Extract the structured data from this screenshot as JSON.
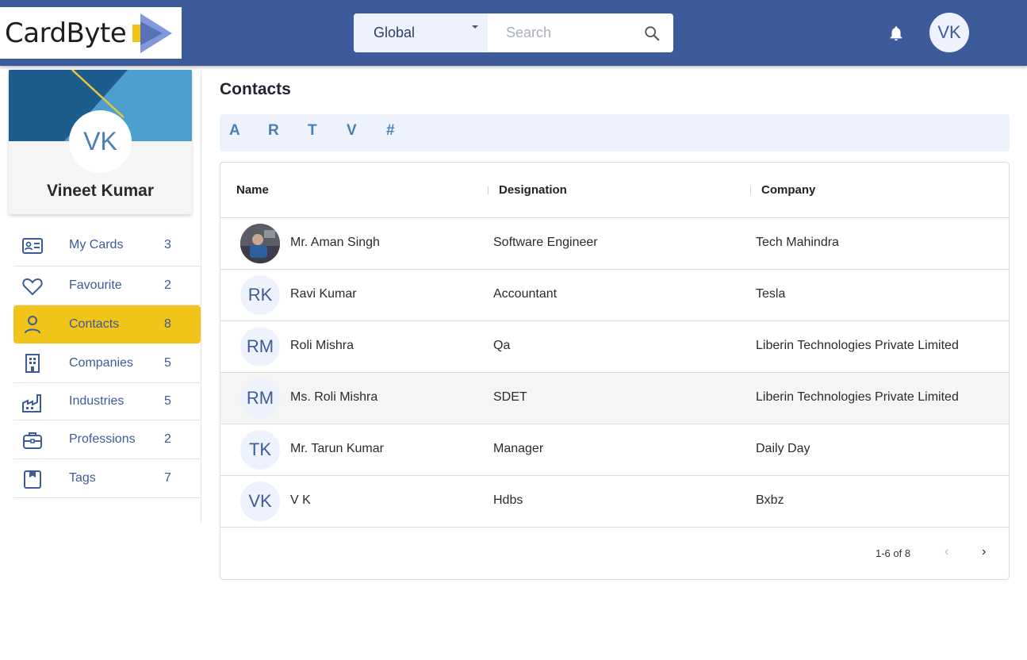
{
  "brand": {
    "logo_text": "CardByte",
    "primary": "#3d5a9b",
    "accent": "#f0c419"
  },
  "header": {
    "scope_value": "Global",
    "search_placeholder": "Search",
    "user_initials": "VK"
  },
  "profile": {
    "initials": "VK",
    "name": "Vineet Kumar"
  },
  "nav": [
    {
      "label": "My Cards",
      "count": "3",
      "icon": "id-card-icon",
      "active": false
    },
    {
      "label": "Favourite",
      "count": "2",
      "icon": "heart-icon",
      "active": false
    },
    {
      "label": "Contacts",
      "count": "8",
      "icon": "person-icon",
      "active": true
    },
    {
      "label": "Companies",
      "count": "5",
      "icon": "building-icon",
      "active": false
    },
    {
      "label": "Industries",
      "count": "5",
      "icon": "factory-icon",
      "active": false
    },
    {
      "label": "Professions",
      "count": "2",
      "icon": "briefcase-icon",
      "active": false
    },
    {
      "label": "Tags",
      "count": "7",
      "icon": "tag-icon",
      "active": false
    }
  ],
  "main": {
    "title": "Contacts",
    "alphabet": [
      "A",
      "R",
      "T",
      "V",
      "#"
    ],
    "columns": [
      "Name",
      "Designation",
      "Company"
    ],
    "rows": [
      {
        "initials": "",
        "photo": true,
        "name": "Mr. Aman Singh",
        "designation": "Software Engineer",
        "company": "Tech Mahindra"
      },
      {
        "initials": "RK",
        "photo": false,
        "name": "Ravi Kumar",
        "designation": "Accountant",
        "company": "Tesla"
      },
      {
        "initials": "RM",
        "photo": false,
        "name": "Roli Mishra",
        "designation": "Qa",
        "company": "Liberin Technologies Private Limited"
      },
      {
        "initials": "RM",
        "photo": false,
        "name": "Ms. Roli Mishra",
        "designation": "SDET",
        "company": "Liberin Technologies Private Limited"
      },
      {
        "initials": "TK",
        "photo": false,
        "name": "Mr. Tarun Kumar",
        "designation": "Manager",
        "company": "Daily Day"
      },
      {
        "initials": "VK",
        "photo": false,
        "name": "V K",
        "designation": "Hdbs",
        "company": "Bxbz"
      }
    ],
    "pagination": {
      "range": "1-6 of 8",
      "prev": "‹",
      "next": "›"
    }
  }
}
